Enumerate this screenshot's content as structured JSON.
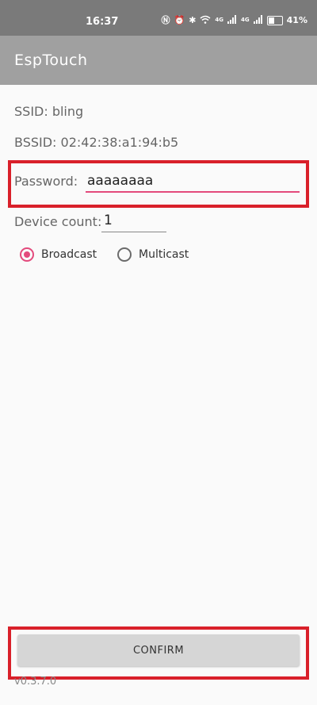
{
  "status_bar": {
    "time": "16:37",
    "icons": [
      "nfc-icon",
      "alarm-icon",
      "bluetooth-icon",
      "wifi-icon",
      "signal-icon",
      "signal-icon-2",
      "battery-icon"
    ],
    "network_1": "4G",
    "network_2": "4G",
    "battery": "41%"
  },
  "app": {
    "title": "EspTouch"
  },
  "wifi": {
    "ssid": "SSID: bling",
    "bssid": "BSSID: 02:42:38:a1:94:b5"
  },
  "password": {
    "label": "Password:",
    "value": "aaaaaaaa"
  },
  "device_count": {
    "label": "Device count:",
    "value": "1"
  },
  "mode": {
    "options": [
      "Broadcast",
      "Multicast"
    ],
    "selected": "Broadcast"
  },
  "actions": {
    "confirm_label": "CONFIRM"
  },
  "version": "v0.3.7.0",
  "colors": {
    "accent": "#e34a7c",
    "highlight": "#d9202a",
    "app_bar": "#a0a0a0",
    "status_bar": "#7a7a7a"
  }
}
